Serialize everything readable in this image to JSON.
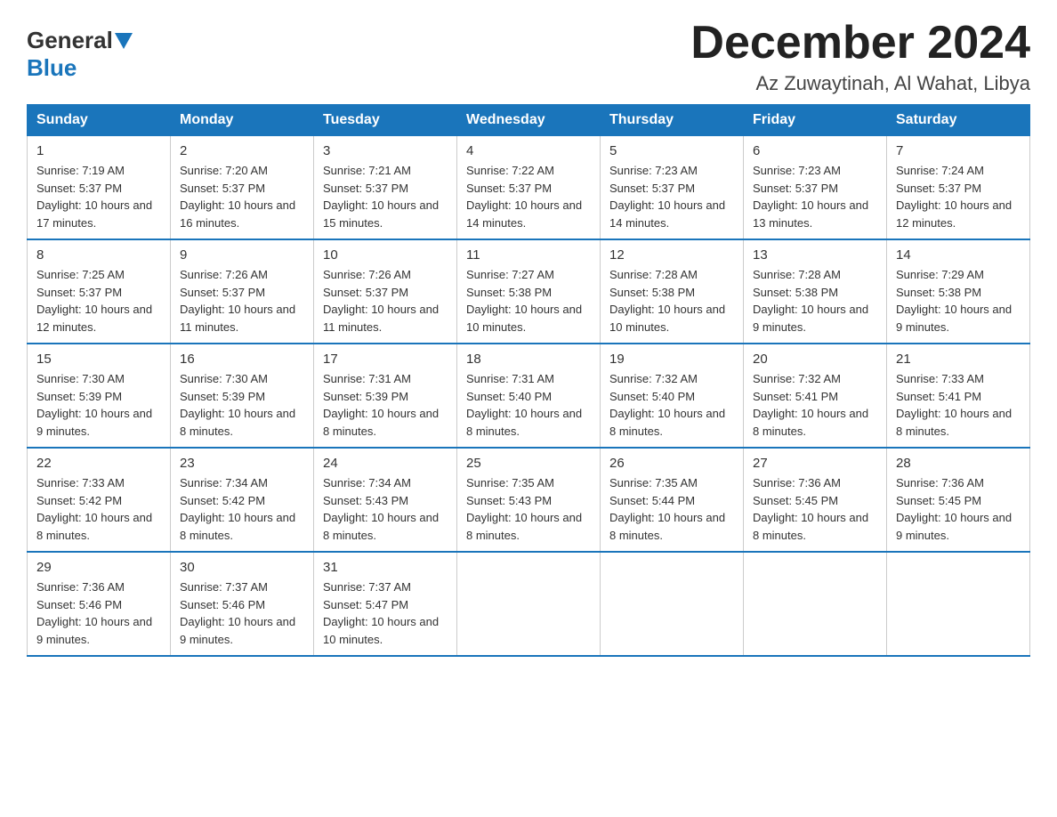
{
  "logo": {
    "general": "General",
    "blue": "Blue"
  },
  "title": "December 2024",
  "location": "Az Zuwaytinah, Al Wahat, Libya",
  "days_of_week": [
    "Sunday",
    "Monday",
    "Tuesday",
    "Wednesday",
    "Thursday",
    "Friday",
    "Saturday"
  ],
  "weeks": [
    [
      {
        "day": "1",
        "sunrise": "7:19 AM",
        "sunset": "5:37 PM",
        "daylight": "10 hours and 17 minutes."
      },
      {
        "day": "2",
        "sunrise": "7:20 AM",
        "sunset": "5:37 PM",
        "daylight": "10 hours and 16 minutes."
      },
      {
        "day": "3",
        "sunrise": "7:21 AM",
        "sunset": "5:37 PM",
        "daylight": "10 hours and 15 minutes."
      },
      {
        "day": "4",
        "sunrise": "7:22 AM",
        "sunset": "5:37 PM",
        "daylight": "10 hours and 14 minutes."
      },
      {
        "day": "5",
        "sunrise": "7:23 AM",
        "sunset": "5:37 PM",
        "daylight": "10 hours and 14 minutes."
      },
      {
        "day": "6",
        "sunrise": "7:23 AM",
        "sunset": "5:37 PM",
        "daylight": "10 hours and 13 minutes."
      },
      {
        "day": "7",
        "sunrise": "7:24 AM",
        "sunset": "5:37 PM",
        "daylight": "10 hours and 12 minutes."
      }
    ],
    [
      {
        "day": "8",
        "sunrise": "7:25 AM",
        "sunset": "5:37 PM",
        "daylight": "10 hours and 12 minutes."
      },
      {
        "day": "9",
        "sunrise": "7:26 AM",
        "sunset": "5:37 PM",
        "daylight": "10 hours and 11 minutes."
      },
      {
        "day": "10",
        "sunrise": "7:26 AM",
        "sunset": "5:37 PM",
        "daylight": "10 hours and 11 minutes."
      },
      {
        "day": "11",
        "sunrise": "7:27 AM",
        "sunset": "5:38 PM",
        "daylight": "10 hours and 10 minutes."
      },
      {
        "day": "12",
        "sunrise": "7:28 AM",
        "sunset": "5:38 PM",
        "daylight": "10 hours and 10 minutes."
      },
      {
        "day": "13",
        "sunrise": "7:28 AM",
        "sunset": "5:38 PM",
        "daylight": "10 hours and 9 minutes."
      },
      {
        "day": "14",
        "sunrise": "7:29 AM",
        "sunset": "5:38 PM",
        "daylight": "10 hours and 9 minutes."
      }
    ],
    [
      {
        "day": "15",
        "sunrise": "7:30 AM",
        "sunset": "5:39 PM",
        "daylight": "10 hours and 9 minutes."
      },
      {
        "day": "16",
        "sunrise": "7:30 AM",
        "sunset": "5:39 PM",
        "daylight": "10 hours and 8 minutes."
      },
      {
        "day": "17",
        "sunrise": "7:31 AM",
        "sunset": "5:39 PM",
        "daylight": "10 hours and 8 minutes."
      },
      {
        "day": "18",
        "sunrise": "7:31 AM",
        "sunset": "5:40 PM",
        "daylight": "10 hours and 8 minutes."
      },
      {
        "day": "19",
        "sunrise": "7:32 AM",
        "sunset": "5:40 PM",
        "daylight": "10 hours and 8 minutes."
      },
      {
        "day": "20",
        "sunrise": "7:32 AM",
        "sunset": "5:41 PM",
        "daylight": "10 hours and 8 minutes."
      },
      {
        "day": "21",
        "sunrise": "7:33 AM",
        "sunset": "5:41 PM",
        "daylight": "10 hours and 8 minutes."
      }
    ],
    [
      {
        "day": "22",
        "sunrise": "7:33 AM",
        "sunset": "5:42 PM",
        "daylight": "10 hours and 8 minutes."
      },
      {
        "day": "23",
        "sunrise": "7:34 AM",
        "sunset": "5:42 PM",
        "daylight": "10 hours and 8 minutes."
      },
      {
        "day": "24",
        "sunrise": "7:34 AM",
        "sunset": "5:43 PM",
        "daylight": "10 hours and 8 minutes."
      },
      {
        "day": "25",
        "sunrise": "7:35 AM",
        "sunset": "5:43 PM",
        "daylight": "10 hours and 8 minutes."
      },
      {
        "day": "26",
        "sunrise": "7:35 AM",
        "sunset": "5:44 PM",
        "daylight": "10 hours and 8 minutes."
      },
      {
        "day": "27",
        "sunrise": "7:36 AM",
        "sunset": "5:45 PM",
        "daylight": "10 hours and 8 minutes."
      },
      {
        "day": "28",
        "sunrise": "7:36 AM",
        "sunset": "5:45 PM",
        "daylight": "10 hours and 9 minutes."
      }
    ],
    [
      {
        "day": "29",
        "sunrise": "7:36 AM",
        "sunset": "5:46 PM",
        "daylight": "10 hours and 9 minutes."
      },
      {
        "day": "30",
        "sunrise": "7:37 AM",
        "sunset": "5:46 PM",
        "daylight": "10 hours and 9 minutes."
      },
      {
        "day": "31",
        "sunrise": "7:37 AM",
        "sunset": "5:47 PM",
        "daylight": "10 hours and 10 minutes."
      },
      null,
      null,
      null,
      null
    ]
  ]
}
